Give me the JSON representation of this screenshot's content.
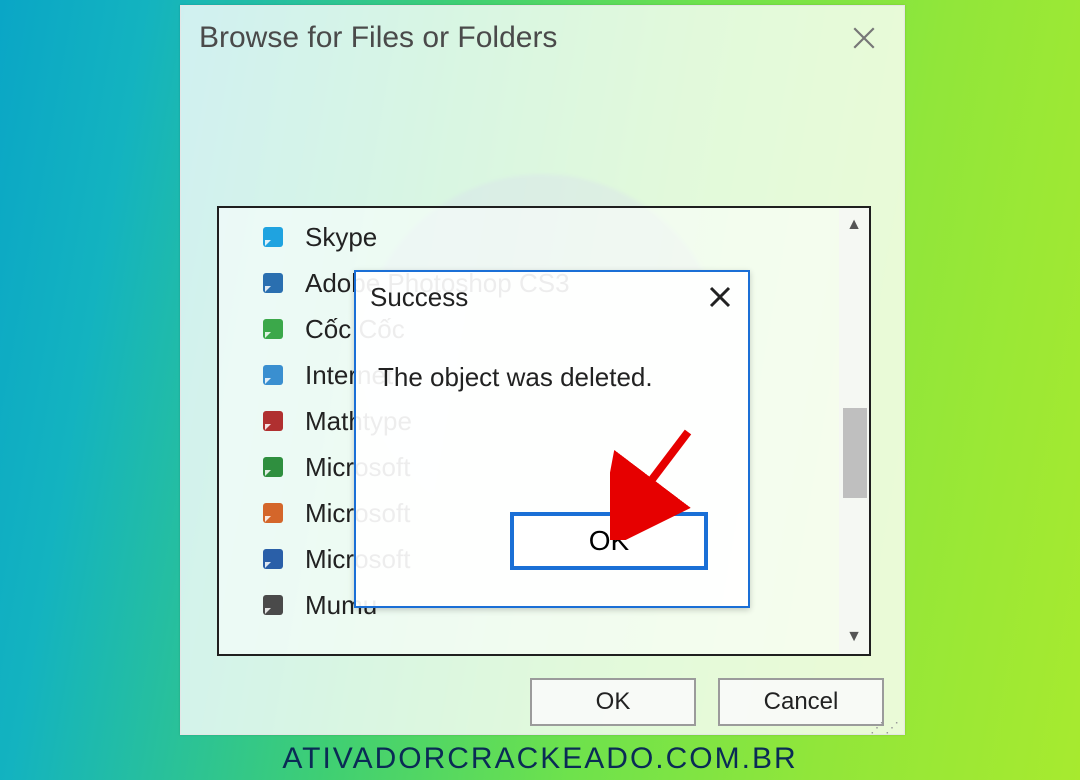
{
  "browse": {
    "title": "Browse for Files or Folders",
    "ok_label": "OK",
    "cancel_label": "Cancel",
    "items": [
      {
        "label": "Skype",
        "icon": "skype-icon",
        "icon_color": "#1fa3e0"
      },
      {
        "label": "Adobe Photoshop CS3",
        "icon": "shortcut-icon",
        "icon_color": "#2a6fb0"
      },
      {
        "label": "Cốc Cốc",
        "icon": "shortcut-icon",
        "icon_color": "#3ba84a"
      },
      {
        "label": "Internet",
        "icon": "shortcut-icon",
        "icon_color": "#3a8fd0"
      },
      {
        "label": "Mathtype",
        "icon": "shortcut-icon",
        "icon_color": "#b03030"
      },
      {
        "label": "Microsoft",
        "icon": "shortcut-icon",
        "icon_color": "#2f8f3f"
      },
      {
        "label": "Microsoft",
        "icon": "shortcut-icon",
        "icon_color": "#d4662a"
      },
      {
        "label": "Microsoft",
        "icon": "shortcut-icon",
        "icon_color": "#2a5fa8"
      },
      {
        "label": "Mumu",
        "icon": "shortcut-icon",
        "icon_color": "#4a4a4a"
      }
    ]
  },
  "modal": {
    "title": "Success",
    "message": "The object was deleted.",
    "ok_label": "OK"
  },
  "watermark": "ATIVADORCRACKEADO.COM.BR",
  "annotation_arrow_color": "#e60000"
}
